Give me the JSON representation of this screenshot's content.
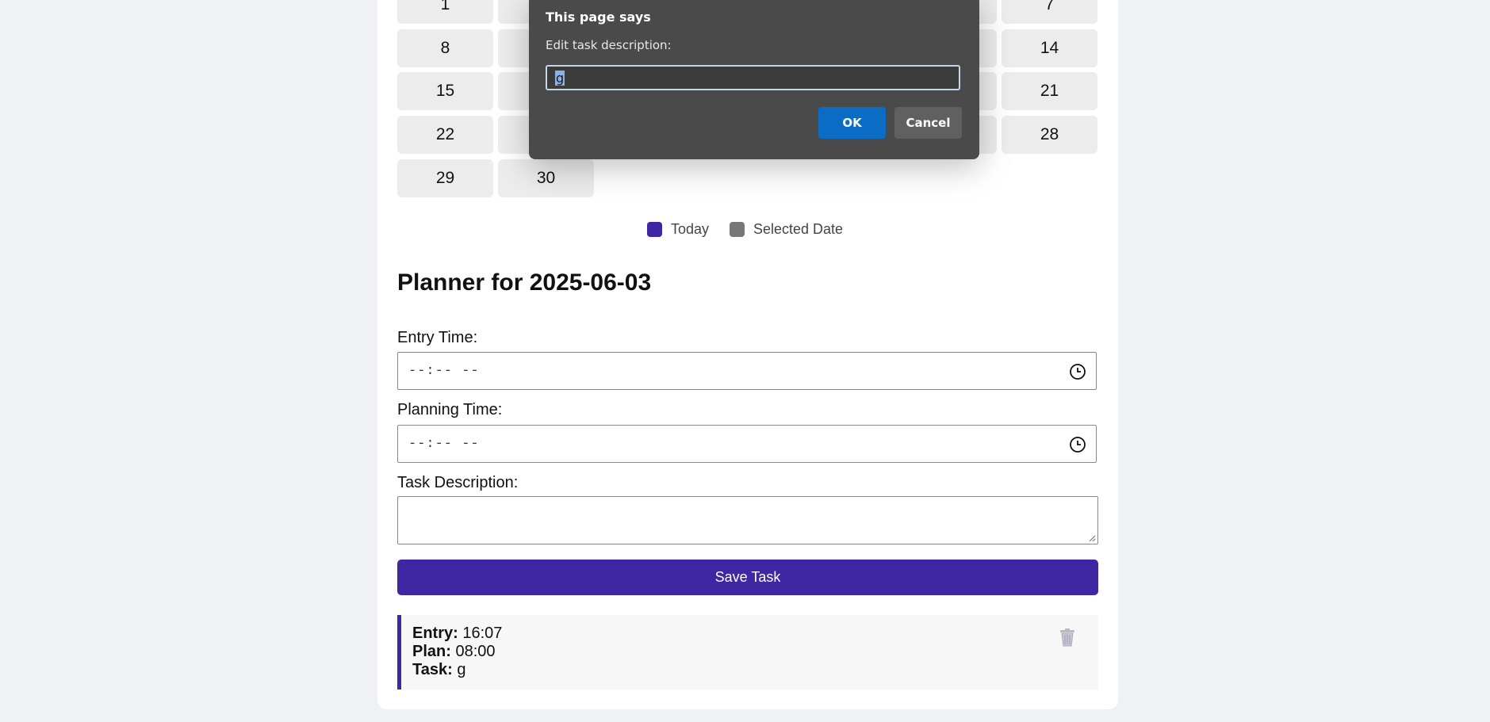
{
  "calendar": {
    "rows": [
      {
        "first": "1",
        "second": "",
        "last": "7"
      },
      {
        "first": "8",
        "second": "",
        "last": "14"
      },
      {
        "first": "15",
        "second": "",
        "last": "21"
      },
      {
        "first": "22",
        "second": "",
        "last": "28"
      },
      {
        "first": "29",
        "second": "30",
        "last": ""
      }
    ]
  },
  "legend": {
    "today_label": "Today",
    "today_color": "#3f27a3",
    "selected_label": "Selected Date",
    "selected_color": "#777777"
  },
  "planner": {
    "title": "Planner for 2025-06-03",
    "entry_time_label": "Entry Time:",
    "entry_time_value": "--:-- --",
    "planning_time_label": "Planning Time:",
    "planning_time_value": "--:-- --",
    "task_description_label": "Task Description:",
    "task_description_value": "",
    "save_button": "Save Task",
    "clock_icon": "clock-icon"
  },
  "task_entry": {
    "entry_label": "Entry:",
    "entry_value": "16:07",
    "plan_label": "Plan:",
    "plan_value": "08:00",
    "task_label": "Task:",
    "task_value": "g",
    "delete_icon": "trash-icon"
  },
  "dialog": {
    "title": "This page says",
    "message": "Edit task description:",
    "input_value": "g",
    "ok_label": "OK",
    "cancel_label": "Cancel"
  }
}
